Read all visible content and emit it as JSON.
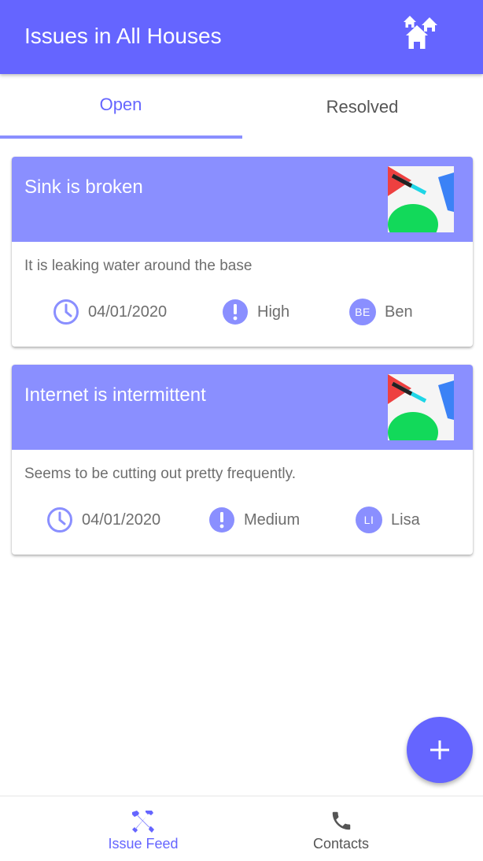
{
  "app_bar": {
    "title": "Issues in All Houses",
    "houses_icon": "houses-icon",
    "background_color": "#6565FF"
  },
  "tabs": [
    {
      "label": "Open",
      "selected": true
    },
    {
      "label": "Resolved",
      "selected": false
    }
  ],
  "issues": [
    {
      "title": "Sink is broken",
      "description": "It is leaking water around the base",
      "date": "04/01/2020",
      "priority": "High",
      "assignee_initials": "BE",
      "assignee_name": "Ben"
    },
    {
      "title": "Internet is intermittent",
      "description": "Seems to be cutting out pretty frequently.",
      "date": "04/01/2020",
      "priority": "Medium",
      "assignee_initials": "LI",
      "assignee_name": "Lisa"
    }
  ],
  "fab": {
    "icon": "plus-icon"
  },
  "bottom_nav": [
    {
      "label": "Issue Feed",
      "icon": "tools-icon",
      "selected": true
    },
    {
      "label": "Contacts",
      "icon": "phone-icon",
      "selected": false
    }
  ],
  "colors": {
    "primary": "#6565FF",
    "card_header": "#8A8FFF",
    "text_secondary": "#6e6e6e"
  }
}
